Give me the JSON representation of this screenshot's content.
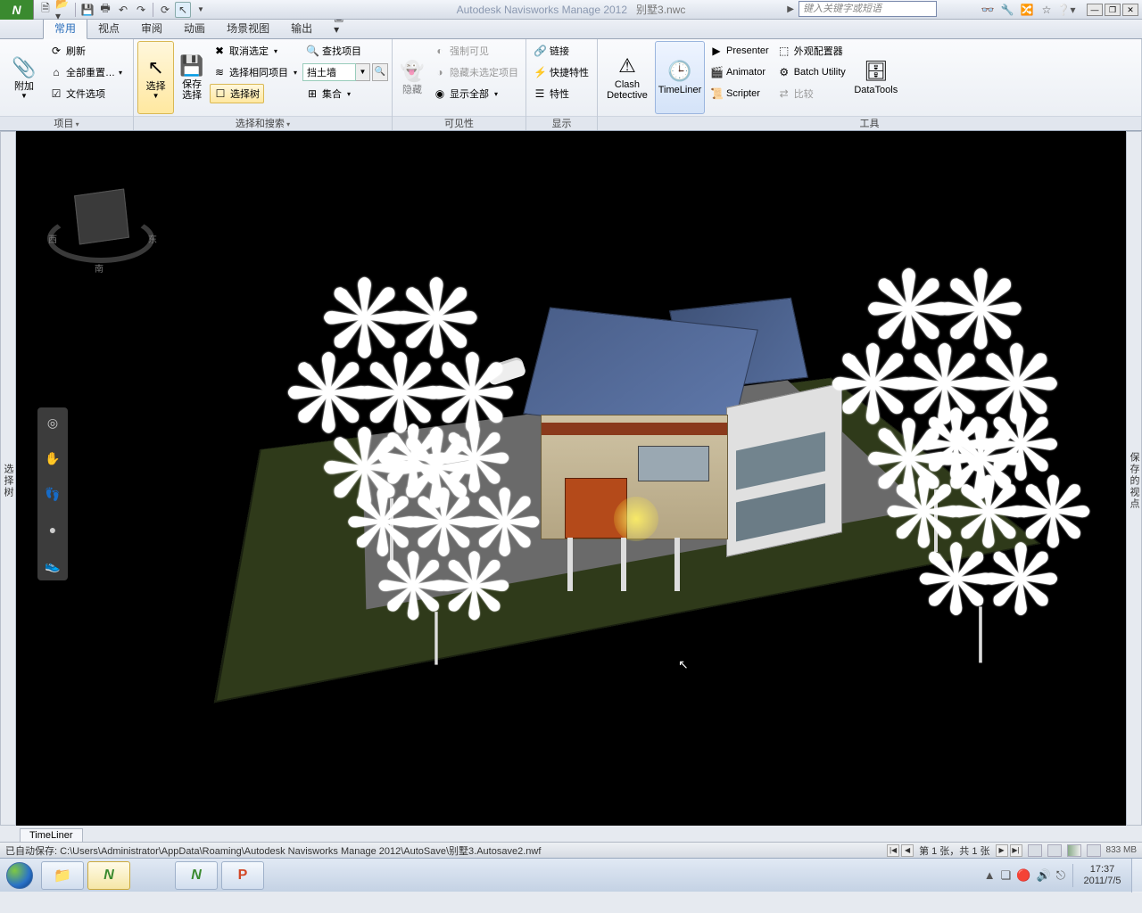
{
  "title": {
    "app": "Autodesk Navisworks Manage 2012",
    "file": "别墅3.nwc",
    "search_placeholder": "键入关键字或短语"
  },
  "qat": [
    "new",
    "open",
    "save",
    "print",
    "undo",
    "redo",
    "sep",
    "refresh",
    "select"
  ],
  "title_right_icons": [
    "binoculars",
    "key",
    "share",
    "star",
    "help"
  ],
  "tabs": {
    "items": [
      "常用",
      "视点",
      "审阅",
      "动画",
      "场景视图",
      "输出"
    ],
    "active_index": 0,
    "ext": "▣ ▾"
  },
  "ribbon": {
    "panels": [
      {
        "title": "项目",
        "drop": true,
        "big": [
          {
            "icon": "📎",
            "label": "附加",
            "sub": "▾"
          }
        ],
        "rows": [
          {
            "icon": "⟳",
            "label": "刷新"
          },
          {
            "icon": "⌂",
            "label": "全部重置…",
            "drop": true
          },
          {
            "icon": "☑",
            "label": "文件选项"
          }
        ]
      },
      {
        "title": "选择和搜索",
        "drop": true,
        "big": [
          {
            "icon": "↖",
            "label": "选择",
            "sub": "▾",
            "active": true
          },
          {
            "icon": "💾",
            "label": "保存\n选择"
          }
        ],
        "btncol": [
          {
            "icon": "☐",
            "label": "选择树",
            "active": true
          }
        ],
        "rows": [
          {
            "icon": "✖",
            "label": "取消选定",
            "drop": true
          },
          {
            "icon": "≋",
            "label": "选择相同项目",
            "drop": true
          },
          {
            "type": "combo",
            "value": "挡土墙"
          },
          {
            "icon": "🔍",
            "label": "查找项目"
          },
          {
            "type": "combo2",
            "icon": "⊞",
            "label": "集合",
            "drop": true
          }
        ]
      },
      {
        "title": "可见性",
        "big": [
          {
            "icon": "👻",
            "label": "隐藏",
            "disabled": true
          }
        ],
        "rows": [
          {
            "icon": "◐",
            "label": "强制可见",
            "disabled": true
          },
          {
            "icon": "◑",
            "label": "隐藏未选定项目",
            "disabled": true
          },
          {
            "icon": "◉",
            "label": "显示全部",
            "drop": true
          }
        ]
      },
      {
        "title": "显示",
        "rows": [
          {
            "icon": "🔗",
            "label": "链接"
          },
          {
            "icon": "⚡",
            "label": "快捷特性"
          },
          {
            "icon": "☰",
            "label": "特性"
          }
        ]
      },
      {
        "title": "工具",
        "big": [
          {
            "icon": "⚠",
            "label": "Clash\nDetective"
          },
          {
            "icon": "🕒",
            "label": "TimeLiner",
            "active2": true
          },
          {
            "icon": "🗄",
            "label": "DataTools"
          }
        ],
        "rows": [
          {
            "icon": "▶",
            "label": "Presenter"
          },
          {
            "icon": "🎬",
            "label": "Animator"
          },
          {
            "icon": "📜",
            "label": "Scripter"
          },
          {
            "icon": "⬚",
            "label": "外观配置器"
          },
          {
            "icon": "⚙",
            "label": "Batch Utility"
          },
          {
            "icon": "⇄",
            "label": "比较",
            "disabled": true
          }
        ]
      }
    ]
  },
  "side_tabs": {
    "left": "选择树",
    "right": "保存的视点"
  },
  "viewcube": {
    "labels": {
      "s": "南",
      "e": "东",
      "w": "西"
    }
  },
  "nav_tools": [
    "◎",
    "✋",
    "👣",
    "●",
    "👟"
  ],
  "bottom_tab": "TimeLiner",
  "status": {
    "text": "已自动保存: C:\\Users\\Administrator\\AppData\\Roaming\\Autodesk Navisworks Manage 2012\\AutoSave\\别墅3.Autosave2.nwf",
    "page": "第 1 张，共 1 张",
    "mem": "833 MB"
  },
  "taskbar": {
    "items": [
      {
        "icon": "📁",
        "color": "#f0c04a"
      },
      {
        "icon": "N",
        "color": "#3a8a2f",
        "active": true
      },
      {
        "sep": true
      },
      {
        "icon": "N",
        "color": "#3a8a2f"
      },
      {
        "icon": "P",
        "color": "#d24726"
      }
    ],
    "tray": [
      "▲",
      "❏",
      "🔴",
      "🔊",
      "⎋"
    ],
    "clock": {
      "time": "17:37",
      "date": "2011/7/5"
    }
  }
}
